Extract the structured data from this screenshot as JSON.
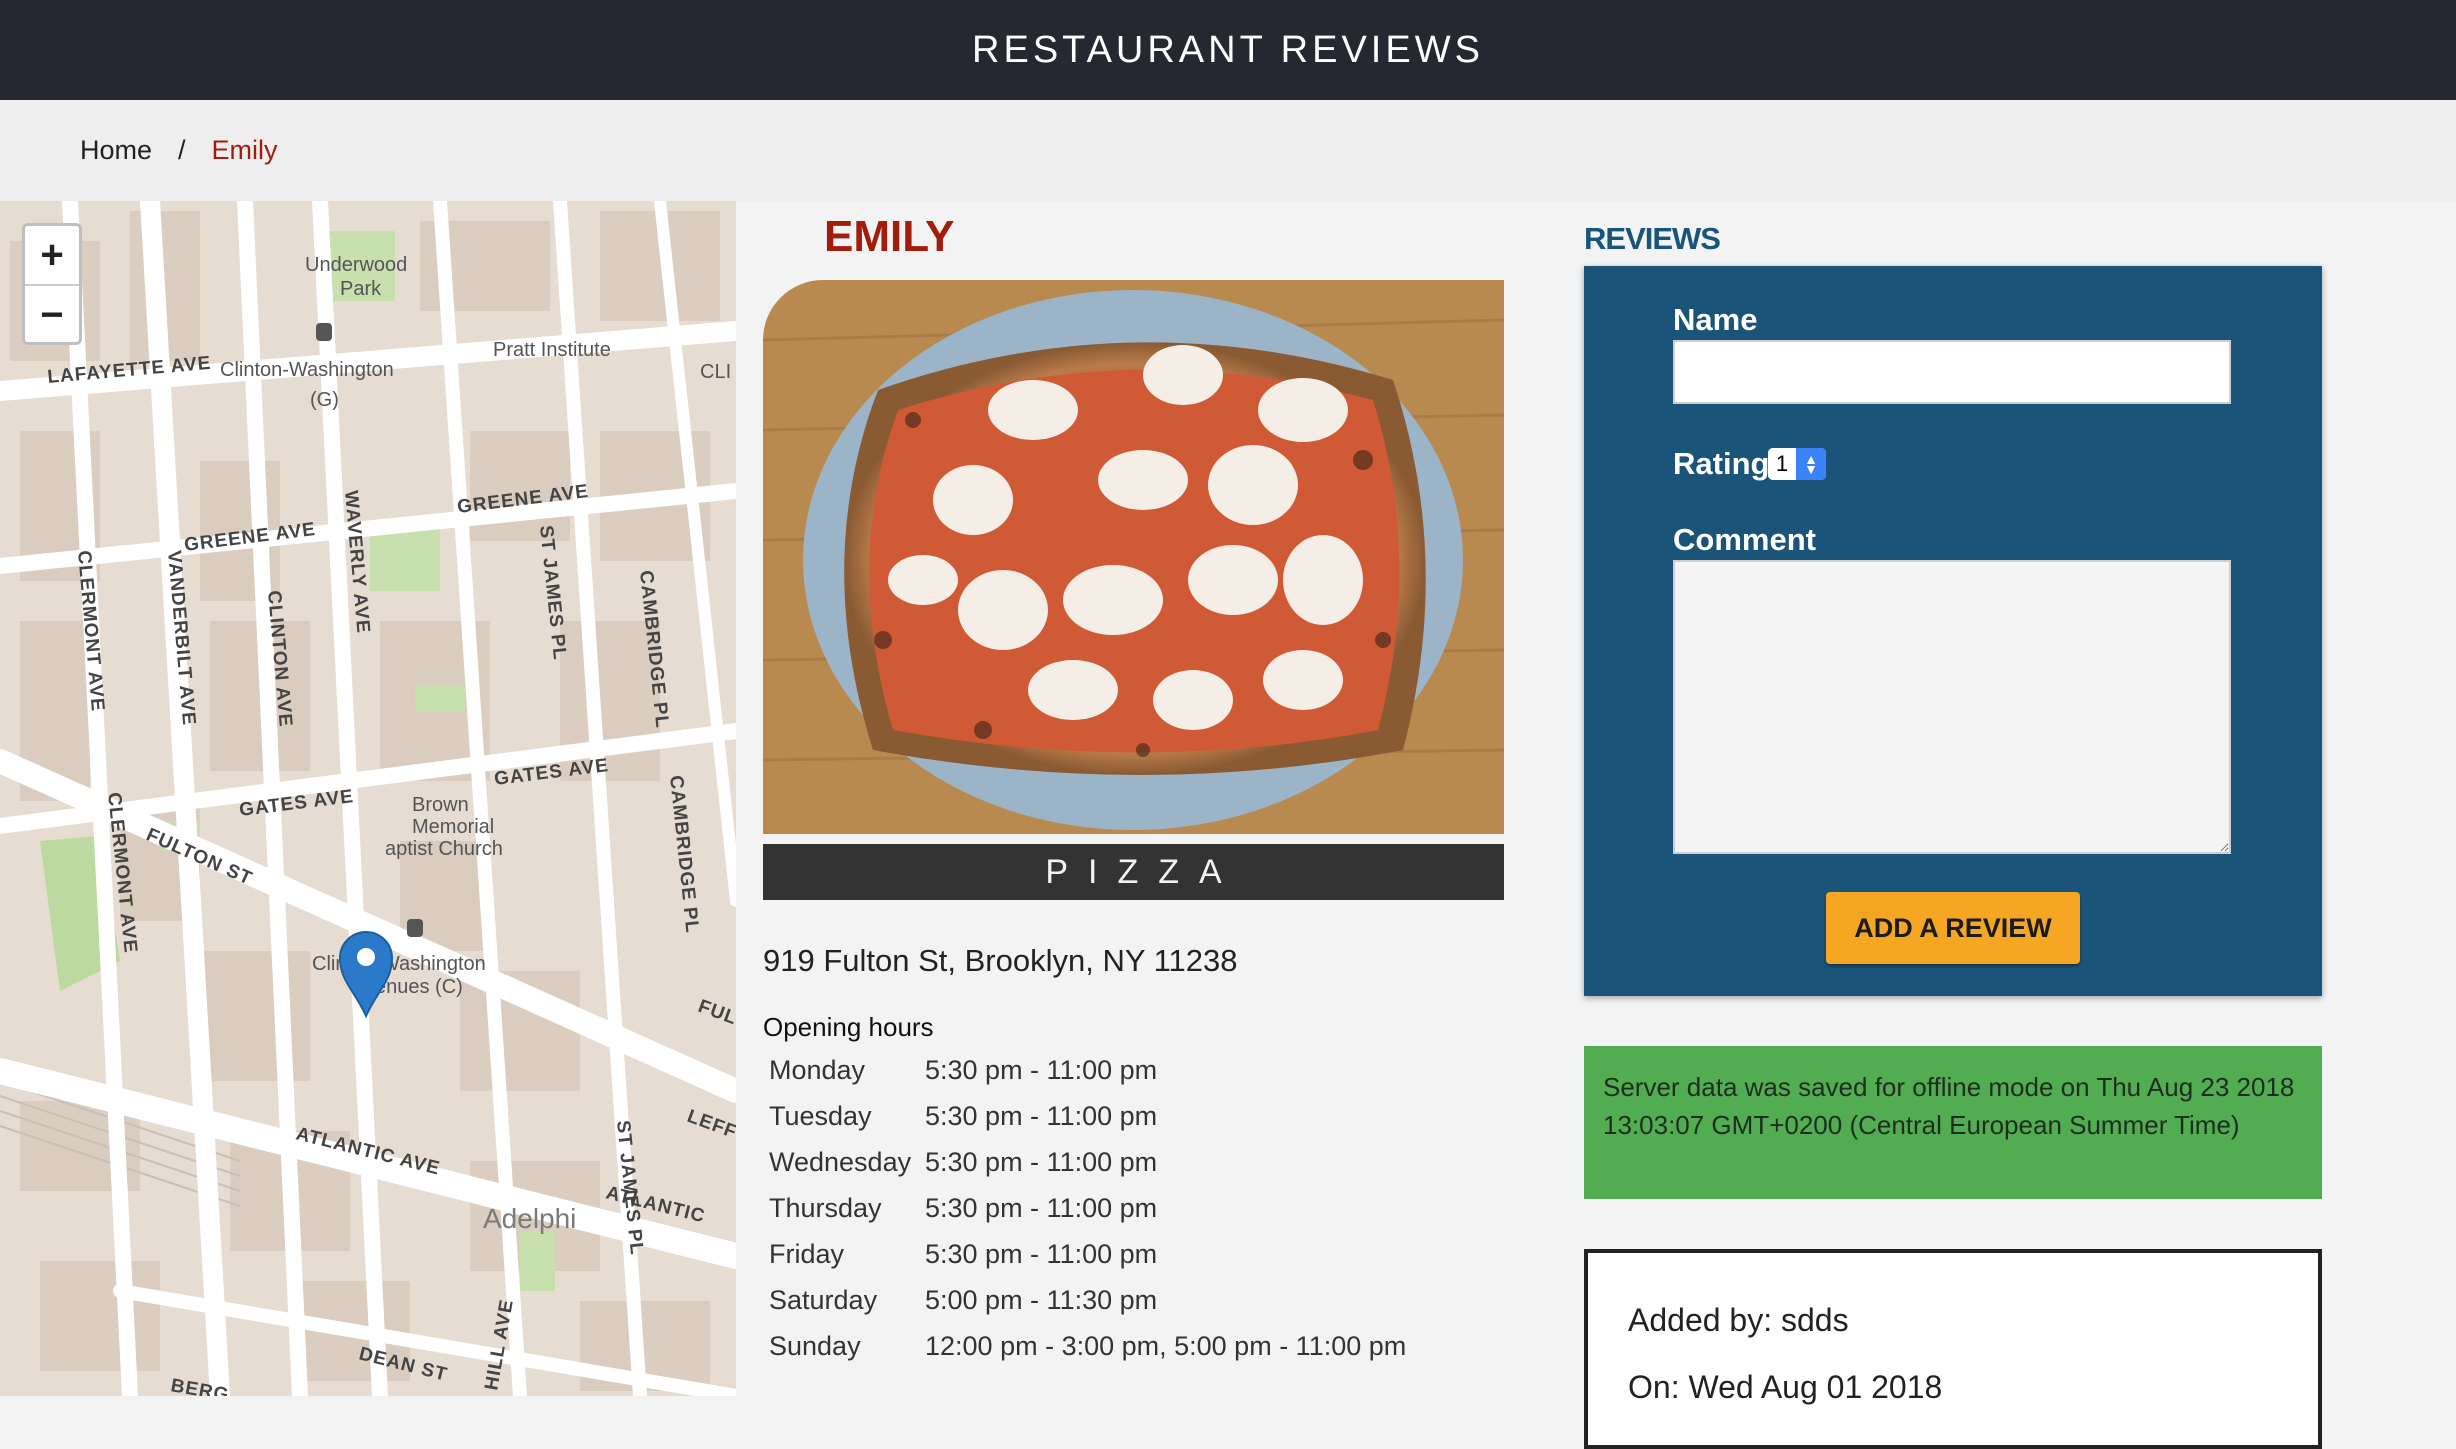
{
  "header": {
    "title": "RESTAURANT REVIEWS"
  },
  "breadcrumb": {
    "home": "Home",
    "separator": "/",
    "current": "Emily"
  },
  "map": {
    "zoom_in": "+",
    "zoom_out": "−",
    "labels": {
      "underwood": "Underwood",
      "park": "Park",
      "pratt": "Pratt Institute",
      "lafayette": "LAFAYETTE AVE",
      "clinton_washington_g_1": "Clinton-Washington",
      "clinton_washington_g_2": "(G)",
      "cli": "CLI",
      "greene_left": "GREENE AVE",
      "greene_right": "GREENE AVE",
      "clermont": "CLERMONT AVE",
      "vanderbilt": "VANDERBILT AVE",
      "clinton_ave": "CLINTON AVE",
      "waverly": "WAVERLY AVE",
      "st_james": "ST JAMES PL",
      "cambridge": "CAMBRIDGE PL",
      "cambridge2": "CAMBRIDGE PL",
      "gates_left": "GATES AVE",
      "gates_right": "GATES AVE",
      "brown": "Brown",
      "memorial": "Memorial",
      "baptist": "aptist Church",
      "fulton": "FULTON ST",
      "clermont2": "CLERMONT AVE",
      "clinton_washington_c_1": "Clinton-Washington",
      "clinton_washington_c_2": "Avenues (C)",
      "ful": "FUL",
      "st_james2": "ST JAMES PL",
      "leff": "LEFF",
      "atlantic": "ATLANTIC AVE",
      "atlantic2": "ATLANTIC",
      "adelphi": "Adelphi",
      "dean": "DEAN ST",
      "hill": "HILL AVE",
      "berg": "BERG"
    }
  },
  "restaurant": {
    "name": "EMILY",
    "cuisine": "PIZZA",
    "address": "919 Fulton St, Brooklyn, NY 11238",
    "hours_title": "Opening hours",
    "hours": [
      {
        "day": "Monday",
        "time": "5:30 pm - 11:00 pm"
      },
      {
        "day": "Tuesday",
        "time": "5:30 pm - 11:00 pm"
      },
      {
        "day": "Wednesday",
        "time": "5:30 pm - 11:00 pm"
      },
      {
        "day": "Thursday",
        "time": "5:30 pm - 11:00 pm"
      },
      {
        "day": "Friday",
        "time": "5:30 pm - 11:00 pm"
      },
      {
        "day": "Saturday",
        "time": "5:00 pm - 11:30 pm"
      },
      {
        "day": "Sunday",
        "time": "12:00 pm - 3:00 pm, 5:00 pm - 11:00 pm"
      }
    ]
  },
  "reviews": {
    "title": "REVIEWS",
    "form": {
      "name_label": "Name",
      "name_value": "",
      "rating_label": "Rating",
      "rating_value": "1",
      "comment_label": "Comment",
      "comment_value": "",
      "submit_label": "ADD A REVIEW"
    },
    "offline_message": "Server data was saved for offline mode on Thu Aug 23 2018 13:03:07 GMT+0200 (Central European Summer Time)",
    "items": [
      {
        "added_by": "Added by: sdds",
        "date": "On: Wed Aug 01 2018"
      }
    ]
  },
  "colors": {
    "header_bg": "#252831",
    "accent_red": "#a31d0c",
    "form_bg": "#1b5479",
    "button": "#f5a623",
    "offline_bg": "#52ac52"
  }
}
